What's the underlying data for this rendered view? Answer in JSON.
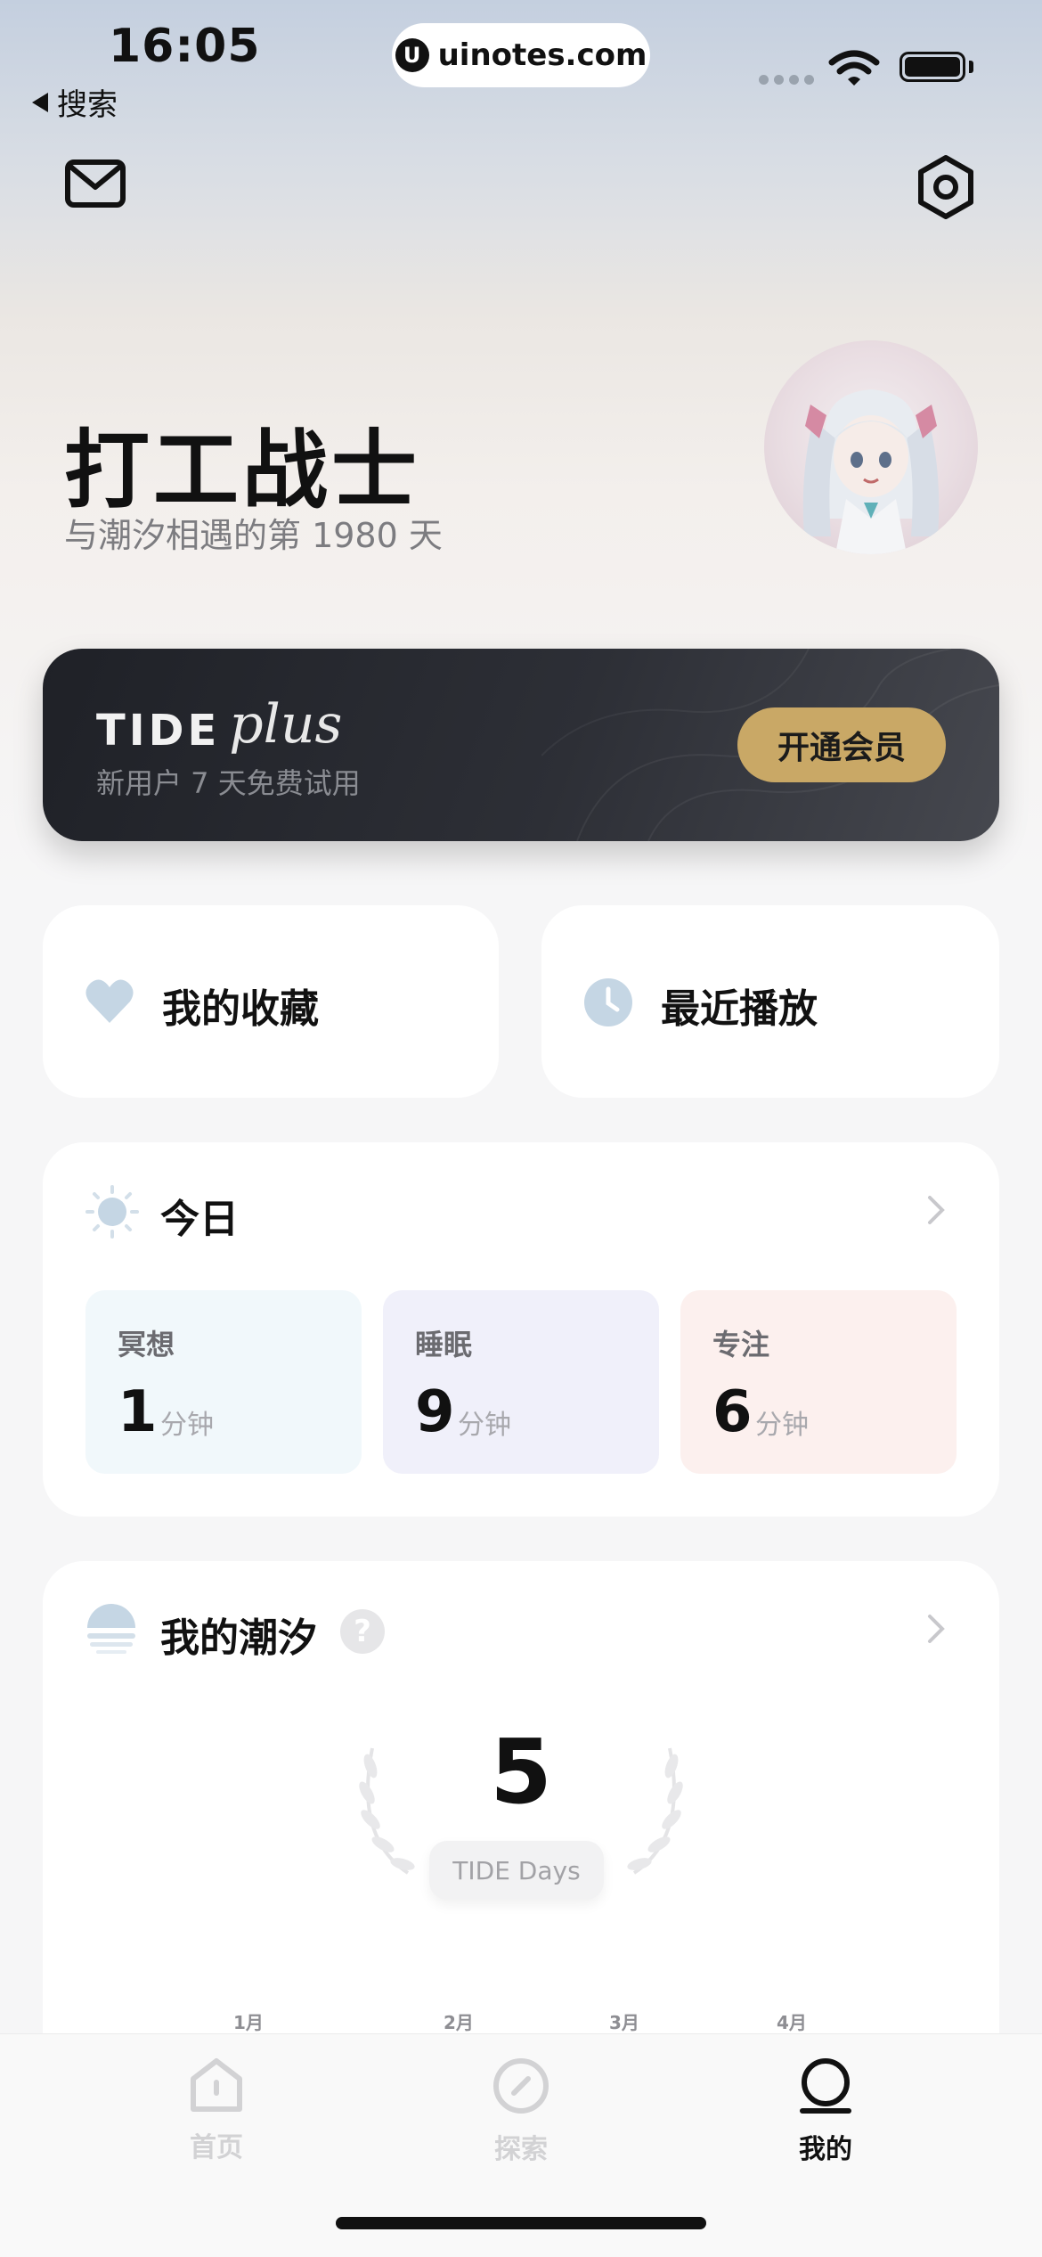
{
  "status_bar": {
    "time": "16:05",
    "back_label": "搜索",
    "url": "uinotes.com",
    "url_badge": "U"
  },
  "profile": {
    "name": "打工战士",
    "days_text": "与潮汐相遇的第 1980 天"
  },
  "plus_card": {
    "brand": "TIDE",
    "brand_script": "plus",
    "subtitle": "新用户 7 天免费试用",
    "button_label": "开通会员"
  },
  "quick_links": {
    "favorites_label": "我的收藏",
    "recent_label": "最近播放"
  },
  "today": {
    "title": "今日",
    "stats": [
      {
        "label": "冥想",
        "value": "1",
        "unit": "分钟",
        "color": "#f1f8fb"
      },
      {
        "label": "睡眠",
        "value": "9",
        "unit": "分钟",
        "color": "#f0f0fa"
      },
      {
        "label": "专注",
        "value": "6",
        "unit": "分钟",
        "color": "#fcf0ee"
      }
    ]
  },
  "my_tide": {
    "title": "我的潮汐",
    "help_glyph": "?",
    "days_count": "5",
    "days_label": "TIDE Days",
    "months": [
      "1月",
      "2月",
      "3月",
      "4月"
    ]
  },
  "tab_bar": {
    "tabs": [
      {
        "label": "首页",
        "icon": "home-icon",
        "active": false
      },
      {
        "label": "探索",
        "icon": "compass-icon",
        "active": false
      },
      {
        "label": "我的",
        "icon": "profile-icon",
        "active": true
      }
    ]
  },
  "colors": {
    "member_button": "#c9a866",
    "plus_card_bg": "#24262c",
    "active_tab": "#111111",
    "inactive_tab": "#d2d2d4"
  }
}
